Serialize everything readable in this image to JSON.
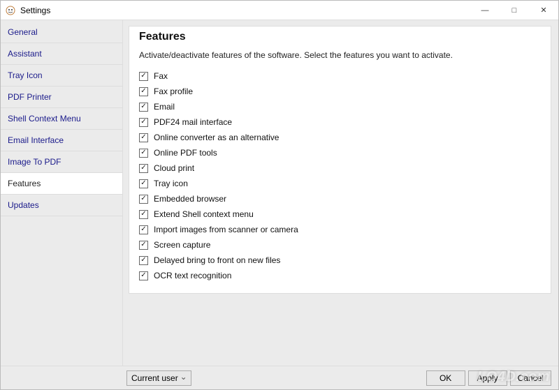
{
  "window": {
    "title": "Settings"
  },
  "sidebar": {
    "items": [
      {
        "label": "General",
        "selected": false
      },
      {
        "label": "Assistant",
        "selected": false
      },
      {
        "label": "Tray Icon",
        "selected": false
      },
      {
        "label": "PDF Printer",
        "selected": false
      },
      {
        "label": "Shell Context Menu",
        "selected": false
      },
      {
        "label": "Email Interface",
        "selected": false
      },
      {
        "label": "Image To PDF",
        "selected": false
      },
      {
        "label": "Features",
        "selected": true
      },
      {
        "label": "Updates",
        "selected": false
      }
    ]
  },
  "main": {
    "heading": "Features",
    "description": "Activate/deactivate features of the software. Select the features you want to activate.",
    "features": [
      {
        "label": "Fax",
        "checked": true
      },
      {
        "label": "Fax profile",
        "checked": true
      },
      {
        "label": "Email",
        "checked": true
      },
      {
        "label": "PDF24 mail interface",
        "checked": true
      },
      {
        "label": "Online converter as an alternative",
        "checked": true
      },
      {
        "label": "Online PDF tools",
        "checked": true
      },
      {
        "label": "Cloud print",
        "checked": true
      },
      {
        "label": "Tray icon",
        "checked": true
      },
      {
        "label": "Embedded browser",
        "checked": true
      },
      {
        "label": "Extend Shell context menu",
        "checked": true
      },
      {
        "label": "Import images from scanner or camera",
        "checked": true
      },
      {
        "label": "Screen capture",
        "checked": true
      },
      {
        "label": "Delayed bring to front on new files",
        "checked": true
      },
      {
        "label": "OCR text recognition",
        "checked": true
      }
    ]
  },
  "footer": {
    "scope": "Current user",
    "buttons": {
      "ok": "OK",
      "apply": "Apply",
      "cancel": "Cancel"
    }
  },
  "watermark": "LO4D.com"
}
